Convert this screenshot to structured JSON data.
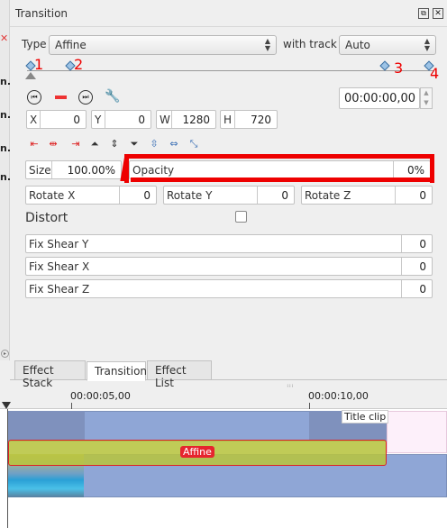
{
  "panel": {
    "title": "Transition"
  },
  "left_strip": {
    "items": [
      "n.",
      "n.",
      "n.",
      "n."
    ]
  },
  "type_row": {
    "type_label": "Type",
    "type_value": "Affine",
    "track_label": "with track",
    "track_value": "Auto"
  },
  "keyframes": {
    "numbers": [
      "1",
      "2",
      "3",
      "4"
    ]
  },
  "timecode": "00:00:00,00",
  "geometry": {
    "x_label": "X",
    "x_value": "0",
    "y_label": "Y",
    "y_value": "0",
    "w_label": "W",
    "w_value": "1280",
    "h_label": "H",
    "h_value": "720"
  },
  "size": {
    "label": "Size",
    "value": "100.00%"
  },
  "opacity": {
    "label": "Opacity",
    "value": "0%"
  },
  "rotate": {
    "x_label": "Rotate X",
    "x_value": "0",
    "y_label": "Rotate Y",
    "y_value": "0",
    "z_label": "Rotate Z",
    "z_value": "0"
  },
  "distort": {
    "label": "Distort",
    "checked": false
  },
  "shears": [
    {
      "label": "Fix Shear Y",
      "value": "0"
    },
    {
      "label": "Fix Shear X",
      "value": "0"
    },
    {
      "label": "Fix Shear Z",
      "value": "0"
    }
  ],
  "tabs": [
    "Effect Stack",
    "Transition",
    "Effect List"
  ],
  "timeline": {
    "ruler": [
      "00:00:05,00",
      "00:00:10,00"
    ],
    "title_clip": "Title clip",
    "transition_label": "Affine"
  },
  "colors": {
    "highlight": "#ee0000",
    "clip_blue": "#8fa6d6",
    "transition_fill": "#b7c440",
    "number_red": "#ee0000"
  }
}
